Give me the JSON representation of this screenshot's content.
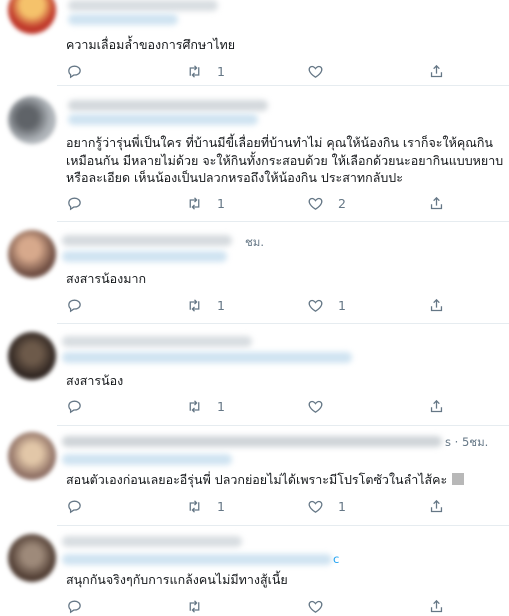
{
  "tweets": [
    {
      "avatar_color": "#c0392b",
      "meta": "",
      "text_lines": [
        "ความเลื่อมล้ำของการศึกษาไทย"
      ],
      "reply_count": "",
      "retweet_count": "1",
      "like_count": ""
    },
    {
      "avatar_color": "#9aa0a6",
      "meta": "",
      "text_lines": [
        "อยากรู้ว่ารุ่นพี่เป็นใคร ที่บ้านมีขี้เลื่อยที่บ้านทำไม่ คุณให้น้องกิน เราก็จะให้คุณกิน",
        "เหมือนกัน มีหลายไม่ด้วย จะให้กินทั้งกระสอบด้วย ให้เลือกด้วยนะอยากินแบบหยาบ",
        "หรือละเอียด เห็นน้องเป็นปลวกหรอถึงให้น้องกิน ประสาทกลับปะ"
      ],
      "reply_count": "",
      "retweet_count": "1",
      "like_count": "2"
    },
    {
      "avatar_color": "#8d6e63",
      "meta": "ชม.",
      "text_lines": [
        "สงสารน้องมาก"
      ],
      "reply_count": "",
      "retweet_count": "1",
      "like_count": "1"
    },
    {
      "avatar_color": "#4e342e",
      "meta": "",
      "text_lines": [
        "สงสารน้อง"
      ],
      "reply_count": "",
      "retweet_count": "1",
      "like_count": ""
    },
    {
      "avatar_color": "#a1887f",
      "meta": "s · 5ชม.",
      "text_lines": [
        "สอนตัวเองก่อนเลยอะอีรุ่นพี่ ปลวกย่อยไม่ได้เพราะมีโปรโตซัวในลำไส้คะ ส"
      ],
      "reply_count": "",
      "retweet_count": "1",
      "like_count": "1"
    },
    {
      "avatar_color": "#795548",
      "meta": "c",
      "text_lines": [
        "สนุกกันจริงๆกับการแกล้งคนไม่มีทางสู้เนี้ย"
      ],
      "reply_count": "",
      "retweet_count": "",
      "like_count": ""
    }
  ],
  "icons": {
    "reply": "reply-icon",
    "retweet": "retweet-icon",
    "like": "heart-icon",
    "share": "share-icon"
  },
  "colors": {
    "text": "#14171a",
    "muted": "#657786",
    "link": "#1da1f2",
    "divider": "#e6ecf0"
  }
}
